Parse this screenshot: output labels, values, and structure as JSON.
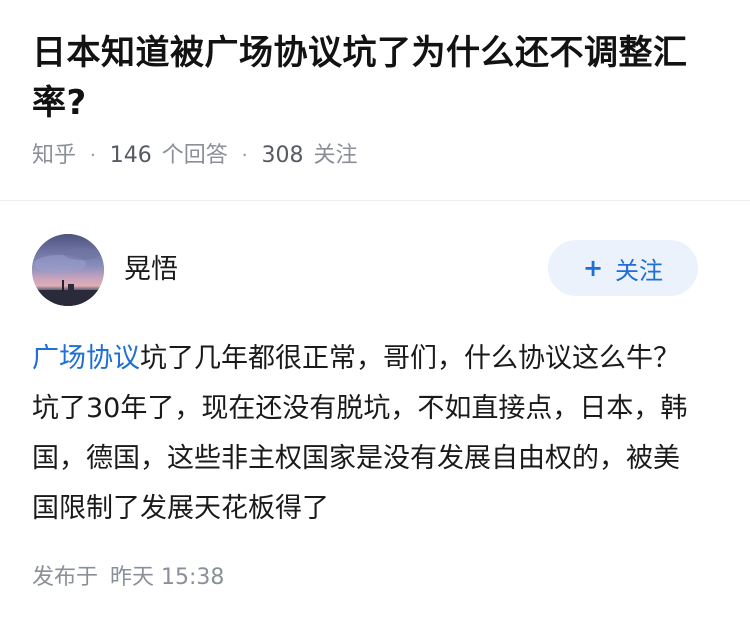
{
  "question": {
    "title": "日本知道被广场协议坑了为什么还不调整汇率?",
    "source": "知乎",
    "separator": "·",
    "answer_count": "146",
    "answer_label": "个回答",
    "follower_count": "308",
    "follower_label": "关注"
  },
  "answer": {
    "author_name": "晃悟",
    "follow_icon": "+",
    "follow_label": "关注",
    "link_text": "广场协议",
    "body_text": "坑了几年都很正常，哥们，什么协议这么牛？坑了30年了，现在还没有脱坑，不如直接点，日本，韩国，德国，这些非主权国家是没有发展自由权的，被美国限制了发展天花板得了",
    "publish_prefix": "发布于",
    "publish_time": "昨天 15:38"
  },
  "colors": {
    "link": "#1f6fd6",
    "follow_bg": "#ebf2fb",
    "meta": "#8a8f99"
  }
}
